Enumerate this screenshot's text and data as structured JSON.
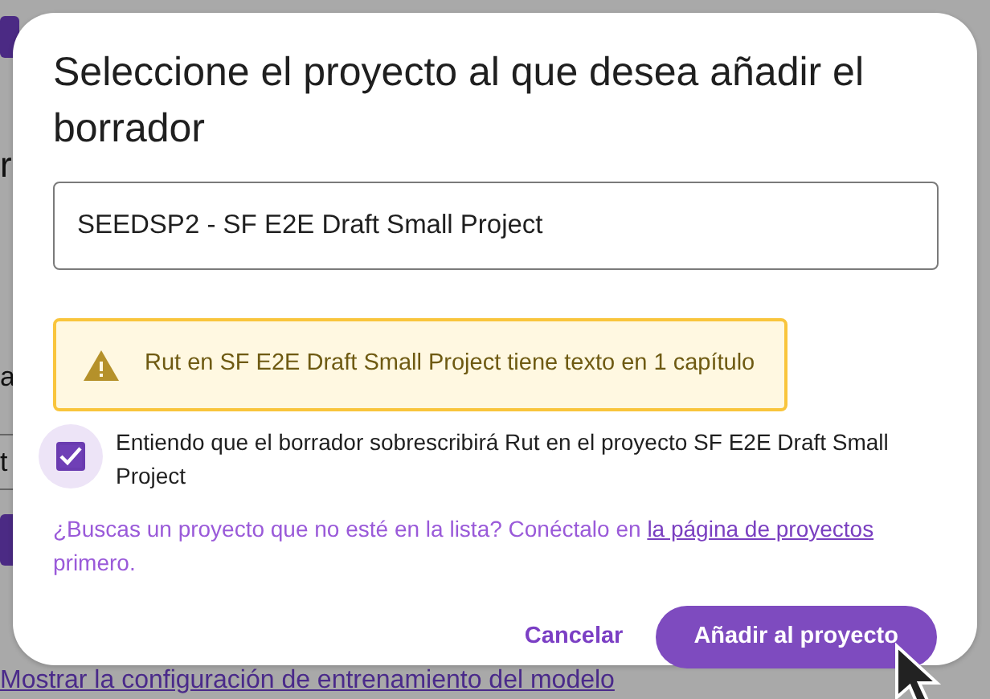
{
  "background": [
    {
      "kind": "text",
      "text": "r"
    },
    {
      "kind": "text",
      "text": "a"
    },
    {
      "kind": "field",
      "text": "t"
    },
    {
      "kind": "link",
      "text": "Mostrar la configuración de entrenamiento del modelo"
    }
  ],
  "dialog": {
    "title": "Seleccione el proyecto al que desea añadir el borrador",
    "project_field": {
      "value": "SEEDSP2 - SF E2E Draft Small Project"
    },
    "warning": {
      "text": "Rut en SF E2E Draft Small Project tiene texto en 1 capítulo"
    },
    "confirm": {
      "label": "Entiendo que el borrador sobrescribirá Rut en el proyecto SF E2E Draft Small Project",
      "checked": true
    },
    "hint": {
      "before": "¿Buscas un proyecto que no esté en la lista? Conéctalo en ",
      "link": "la página de proyectos",
      "after": " primero."
    },
    "buttons": [
      {
        "label": "Cancelar",
        "kind": "text"
      },
      {
        "label": "Añadir al proyecto",
        "kind": "primary"
      }
    ]
  }
}
